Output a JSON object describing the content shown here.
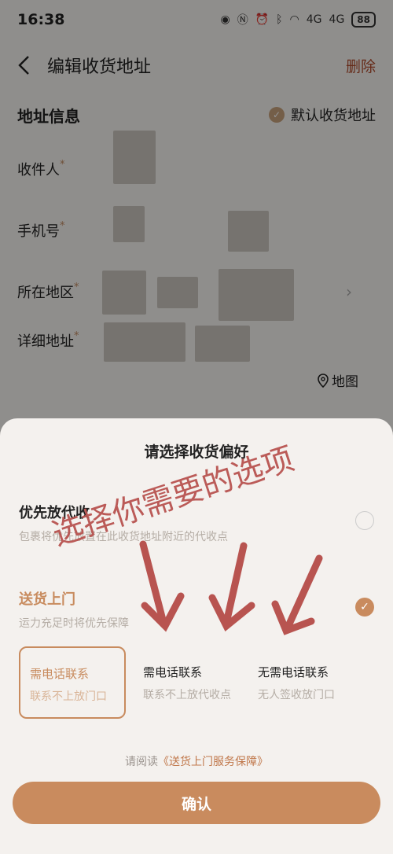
{
  "status": {
    "time": "16:38",
    "battery": "88",
    "net1": "4G",
    "net2": "4G"
  },
  "nav": {
    "title": "编辑收货地址",
    "delete": "删除"
  },
  "address": {
    "section_title": "地址信息",
    "default_label": "默认收货地址",
    "fields": {
      "recipient": "收件人",
      "phone": "手机号",
      "region": "所在地区",
      "detail": "详细地址"
    },
    "required_mark": "*",
    "map_label": "地图"
  },
  "sheet": {
    "title": "请选择收货偏好",
    "option1": {
      "title": "优先放代收",
      "sub": "包裹将优先放置在此收货地址附近的代收点"
    },
    "option2": {
      "title": "送货上门",
      "sub": "运力充足时将优先保障"
    },
    "sub_options": [
      {
        "title": "需电话联系",
        "sub": "联系不上放门口"
      },
      {
        "title": "需电话联系",
        "sub": "联系不上放代收点"
      },
      {
        "title": "无需电话联系",
        "sub": "无人签收放门口"
      }
    ],
    "agreement_prefix": "请阅读",
    "agreement_link": "《送货上门服务保障》",
    "confirm": "确认"
  },
  "annotation": {
    "text": "选择你需要的选项"
  },
  "colors": {
    "accent": "#c98b5e",
    "annotation": "#b85450"
  }
}
